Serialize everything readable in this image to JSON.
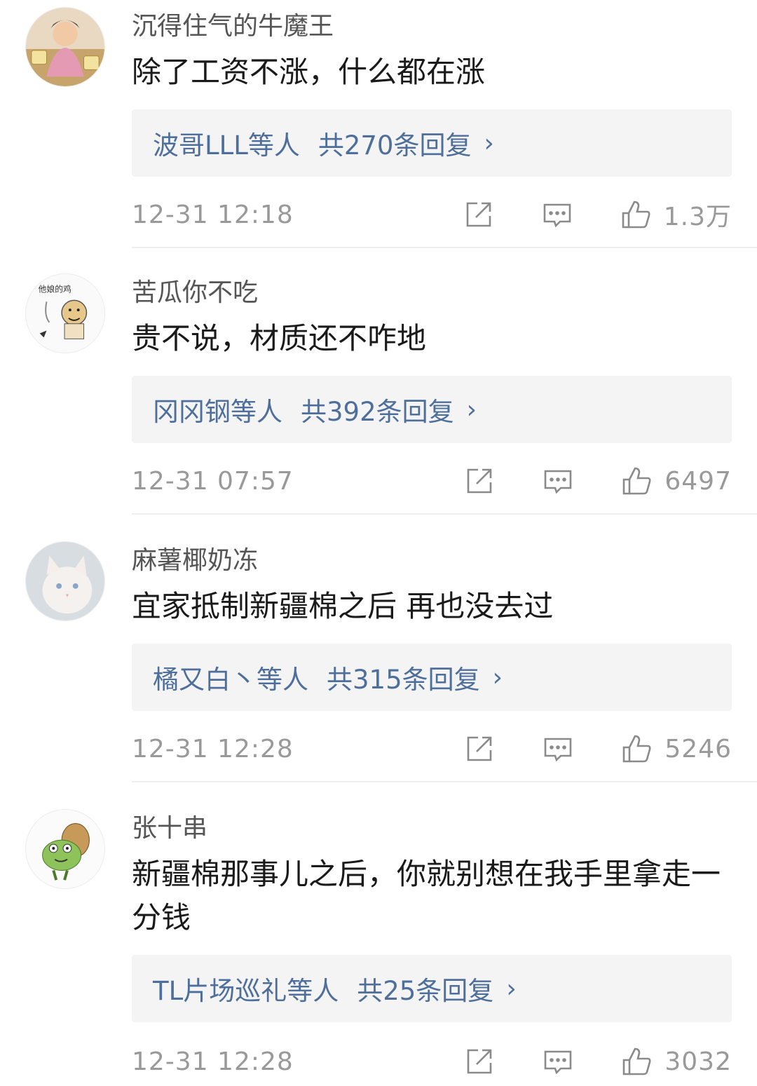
{
  "comments": [
    {
      "username": "沉得住气的牛魔王",
      "content": "除了工资不涨，什么都在涨",
      "replies_by": "波哥LLL等人",
      "replies_total": "共270条回复",
      "time": "12-31 12:18",
      "likes": "1.3万",
      "avatar": "avatar-photo-icon"
    },
    {
      "username": "苦瓜你不吃",
      "content": "贵不说，材质还不咋地",
      "replies_by": "冈冈钢等人",
      "replies_total": "共392条回复",
      "time": "12-31 07:57",
      "likes": "6497",
      "avatar": "avatar-meme-icon"
    },
    {
      "username": "麻薯椰奶冻",
      "content": "宜家抵制新疆棉之后 再也没去过",
      "replies_by": "橘又白丶等人",
      "replies_total": "共315条回复",
      "time": "12-31 12:28",
      "likes": "5246",
      "avatar": "avatar-kitten-icon"
    },
    {
      "username": "张十串",
      "content": "新疆棉那事儿之后，你就别想在我手里拿走一分钱",
      "replies_by": "TL片场巡礼等人",
      "replies_total": "共25条回复",
      "time": "12-31 12:28",
      "likes": "3032",
      "avatar": "avatar-frog-icon"
    }
  ],
  "icons": {
    "share": "share-icon",
    "comment": "comment-icon",
    "like": "thumbs-up-icon",
    "chevron": "chevron-right-icon"
  },
  "colors": {
    "link": "#4e6f9c",
    "reply_bg": "#f4f4f4",
    "meta_text": "#999999"
  }
}
